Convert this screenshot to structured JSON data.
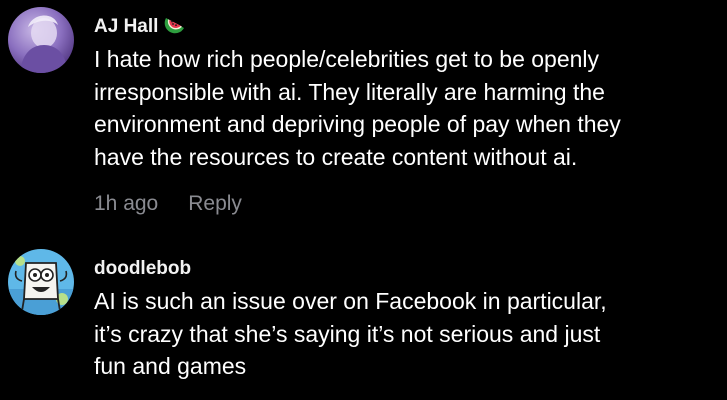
{
  "comments": [
    {
      "author": "AJ Hall",
      "badge_icon": "watermelon-icon",
      "avatar_icon": "profile-photo",
      "text_lines": [
        "I hate how rich people/celebrities get to be openly",
        "irresponsible with ai. They literally are harming the",
        "environment and depriving people of pay when they",
        "have the resources to create content without ai."
      ],
      "timestamp": "1h ago",
      "reply_label": "Reply"
    },
    {
      "author": "doodlebob",
      "avatar_icon": "doodlebob-avatar",
      "text_lines": [
        "AI is such an issue over on Facebook in particular,",
        "it’s crazy that she’s saying it’s not serious and just",
        "fun and games"
      ]
    }
  ],
  "colors": {
    "background": "#000000",
    "text": "#ffffff",
    "meta_text": "#8a8b91"
  }
}
